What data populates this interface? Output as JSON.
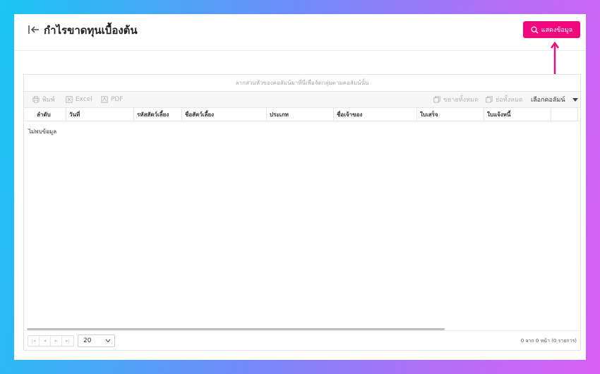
{
  "header": {
    "title": "กำไรขาดทุนเบื้องต้น",
    "show_button_label": "แสดงข้อมูล"
  },
  "grid": {
    "group_panel_hint": "ลากส่วนหัวของคอลัมน์มาที่นี่เพื่อจัดกลุ่มตามคอลัมน์นั้น",
    "toolbar": {
      "print": "พิมพ์",
      "excel": "Excel",
      "pdf": "PDF",
      "expand_all": "ขยายทั้งหมด",
      "collapse_all": "ย่อทั้งหมด",
      "choose_columns": "เลือกคอลัมน์"
    },
    "columns": [
      "ลำดับ",
      "วันที่",
      "รหัสสัตว์เลี้ยง",
      "ชื่อสัตว์เลี้ยง",
      "ประเภท",
      "ชื่อเจ้าของ",
      "ใบเสร็จ",
      "ใบแจ้งหนี้"
    ],
    "no_data": "ไม่พบข้อมูล",
    "pager": {
      "page_size": "20",
      "info": "0 จาก 0 หน้า (0 รายการ)"
    }
  },
  "colors": {
    "accent": "#f0087c"
  }
}
